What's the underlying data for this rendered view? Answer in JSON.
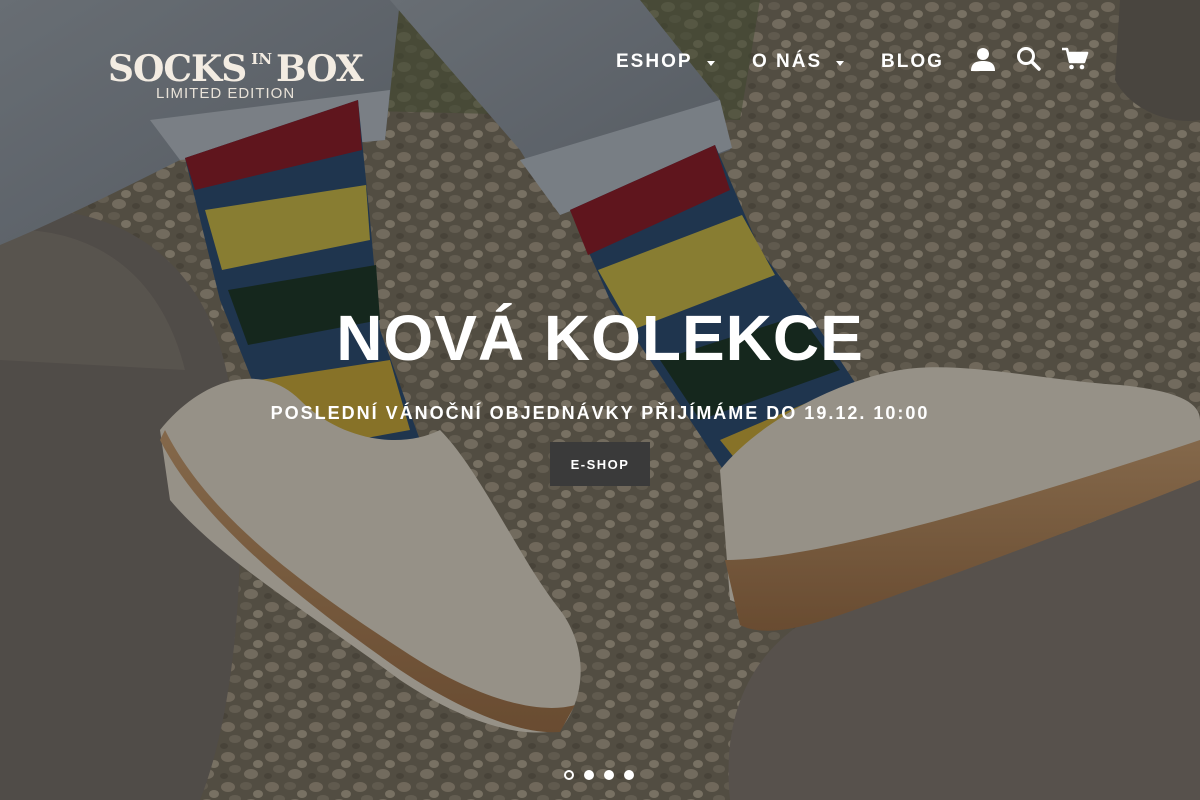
{
  "logo": {
    "word1": "SOCKS",
    "word_small": "IN",
    "word2": "BOX",
    "subtitle": "LIMITED EDITION"
  },
  "nav": {
    "items": [
      {
        "label": "ESHOP",
        "has_dropdown": true
      },
      {
        "label": "O NÁS",
        "has_dropdown": true
      },
      {
        "label": "BLOG",
        "has_dropdown": false
      }
    ],
    "icons": [
      "account-icon",
      "search-icon",
      "cart-icon"
    ]
  },
  "hero": {
    "title": "NOVÁ KOLEKCE",
    "subtitle": "POSLEDNÍ VÁNOČNÍ OBJEDNÁVKY PŘIJÍMÁME DO 19.12. 10:00",
    "button_label": "E-SHOP"
  },
  "slideshow": {
    "slide_count": 4,
    "active_index": 0
  },
  "colors": {
    "text": "#ffffff",
    "button_bg": "#3a3a3a",
    "logo": "#f3ece2"
  }
}
